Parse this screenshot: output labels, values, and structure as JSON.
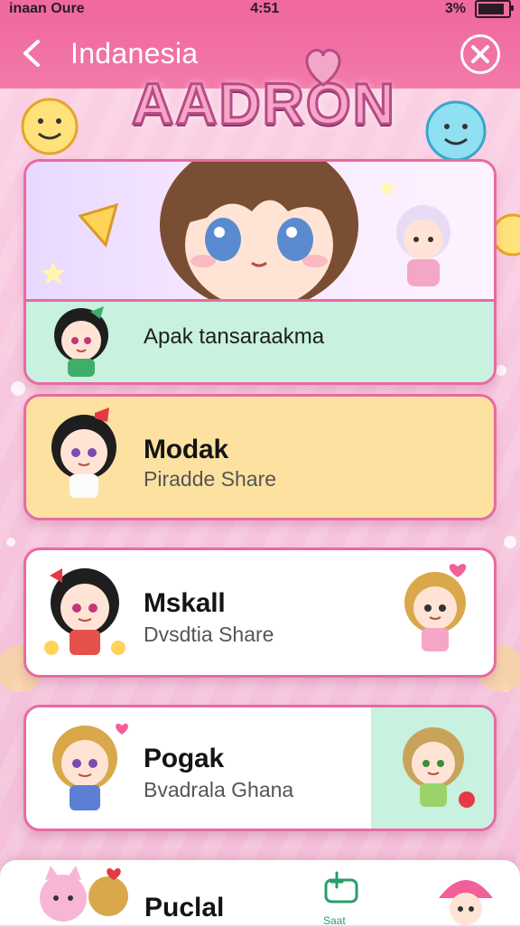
{
  "status_bar": {
    "left_text": "inaan Oure",
    "time": "4:51",
    "right_text": "3%",
    "battery_level": 0.95
  },
  "header": {
    "title": "Indanesia",
    "back_icon": "chevron-left-icon",
    "action_icon": "close-circle-icon"
  },
  "logo": {
    "text": "AADRON"
  },
  "cards": [
    {
      "title": "",
      "subtitle": "Apak tansaraakma",
      "type": "hero"
    },
    {
      "title": "Modak",
      "subtitle": "Piradde Share"
    },
    {
      "title": "Mskall",
      "subtitle": "Dvsdtia Share"
    },
    {
      "title": "Pogak",
      "subtitle": "Bvadrala Ghana"
    }
  ],
  "bottom_sheet": {
    "title": "Puclal",
    "action_label": "Saat"
  },
  "colors": {
    "header": "#f06aa0",
    "card_border": "#e86aa2",
    "mint": "#c8f1df",
    "yellow": "#fde1a0"
  }
}
